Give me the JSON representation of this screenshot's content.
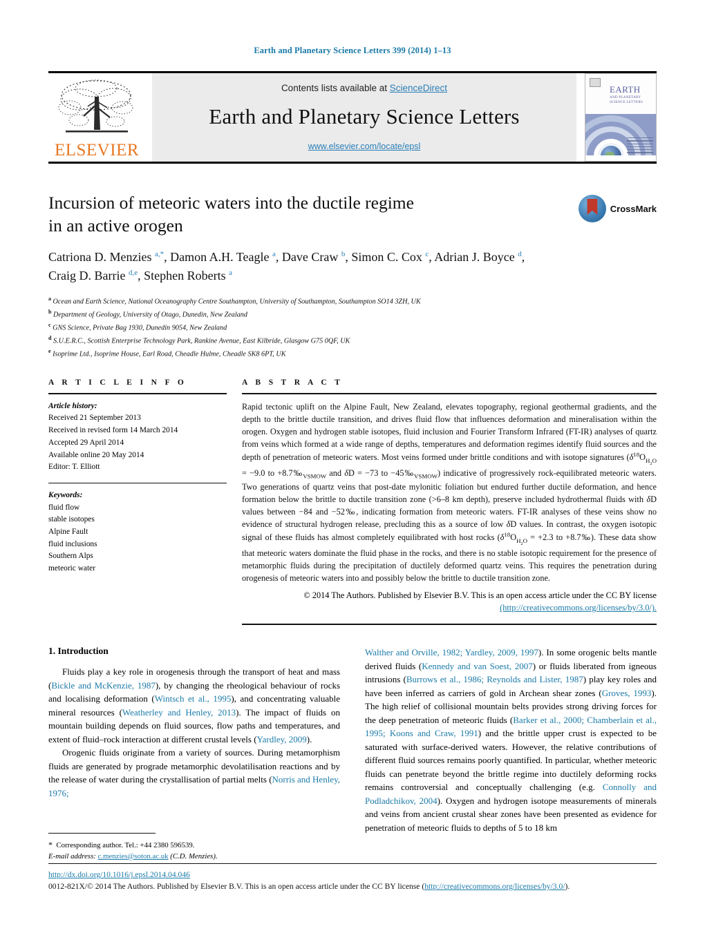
{
  "running_head": "Earth and Planetary Science Letters 399 (2014) 1–13",
  "masthead": {
    "publisher": "ELSEVIER",
    "contents_prefix": "Contents lists available at ",
    "contents_link": "ScienceDirect",
    "journal_title": "Earth and Planetary Science Letters",
    "journal_url": "www.elsevier.com/locate/epsl",
    "cover": {
      "title": "EARTH",
      "subtitle": "AND PLANETARY SCIENCE LETTERS"
    }
  },
  "article": {
    "title_line1": "Incursion of meteoric waters into the ductile regime",
    "title_line2": "in an active orogen",
    "crossmark_label": "CrossMark",
    "authors_html": "Catriona D. Menzies <sup>a,*</sup>, Damon A.H. Teagle <sup>a</sup>, Dave Craw <sup>b</sup>, Simon C. Cox <sup>c</sup>, Adrian J. Boyce <sup>d</sup>, Craig D. Barrie <sup>d,e</sup>, Stephen Roberts <sup>a</sup>",
    "affiliations": [
      {
        "mark": "a",
        "text": "Ocean and Earth Science, National Oceanography Centre Southampton, University of Southampton, Southampton SO14 3ZH, UK"
      },
      {
        "mark": "b",
        "text": "Department of Geology, University of Otago, Dunedin, New Zealand"
      },
      {
        "mark": "c",
        "text": "GNS Science, Private Bag 1930, Dunedin 9054, New Zealand"
      },
      {
        "mark": "d",
        "text": "S.U.E.R.C., Scottish Enterprise Technology Park, Rankine Avenue, East Kilbride, Glasgow G75 0QF, UK"
      },
      {
        "mark": "e",
        "text": "Isoprime Ltd., Isoprime House, Earl Road, Cheadle Hulme, Cheadle SK8 6PT, UK"
      }
    ]
  },
  "article_info": {
    "heading": "A R T I C L E   I N F O",
    "history_label": "Article history:",
    "history": [
      "Received 21 September 2013",
      "Received in revised form 14 March 2014",
      "Accepted 29 April 2014",
      "Available online 20 May 2014",
      "Editor: T. Elliott"
    ],
    "keywords_label": "Keywords:",
    "keywords": [
      "fluid flow",
      "stable isotopes",
      "Alpine Fault",
      "fluid inclusions",
      "Southern Alps",
      "meteoric water"
    ]
  },
  "abstract": {
    "heading": "A B S T R A C T",
    "text_html": "Rapid tectonic uplift on the Alpine Fault, New Zealand, elevates topography, regional geothermal gradients, and the depth to the brittle ductile transition, and drives fluid flow that influences deformation and mineralisation within the orogen. Oxygen and hydrogen stable isotopes, fluid inclusion and Fourier Transform Infrared (FT-IR) analyses of quartz from veins which formed at a wide range of depths, temperatures and deformation regimes identify fluid sources and the depth of penetration of meteoric waters. Most veins formed under brittle conditions and with isotope signatures (<span class=\"ital\">δ</span><sup>18</sup>O<sub>H<sub>2</sub>O</sub> = −9.0 to +8.7‰<sub>VSMOW</sub> and <span class=\"ital\">δ</span>D = −73 to −45‰<sub>VSMOW</sub>) indicative of progressively rock-equilibrated meteoric waters. Two generations of quartz veins that post-date mylonitic foliation but endured further ductile deformation, and hence formation below the brittle to ductile transition zone (&gt;6–8 km depth), preserve included hydrothermal fluids with <span class=\"ital\">δ</span>D values between −84 and −52‰, indicating formation from meteoric waters. FT-IR analyses of these veins show no evidence of structural hydrogen release, precluding this as a source of low <span class=\"ital\">δ</span>D values. In contrast, the oxygen isotopic signal of these fluids has almost completely equilibrated with host rocks (<span class=\"ital\">δ</span><sup>18</sup>O<sub>H<sub>2</sub>O</sub> = +2.3 to +8.7‰). These data show that meteoric waters dominate the fluid phase in the rocks, and there is no stable isotopic requirement for the presence of metamorphic fluids during the precipitation of ductilely deformed quartz veins. This requires the penetration during orogenesis of meteoric waters into and possibly below the brittle to ductile transition zone.",
    "copyright_text": "© 2014 The Authors. Published by Elsevier B.V. This is an open access article under the CC BY license",
    "license_url": "(http://creativecommons.org/licenses/by/3.0/)."
  },
  "body": {
    "section_number_title": "1.  Introduction",
    "left_paragraphs_html": [
      "Fluids play a key role in orogenesis through the transport of heat and mass (<span class=\"ref\">Bickle and McKenzie, 1987</span>), by changing the rheological behaviour of rocks and localising deformation (<span class=\"ref\">Wintsch et al., 1995</span>), and concentrating valuable mineral resources (<span class=\"ref\">Weatherley and Henley, 2013</span>). The impact of fluids on mountain building depends on fluid sources, flow paths and temperatures, and extent of fluid–rock interaction at different crustal levels (<span class=\"ref\">Yardley, 2009</span>).",
      "Orogenic fluids originate from a variety of sources. During metamorphism fluids are generated by prograde metamorphic devolatilisation reactions and by the release of water during the crystallisation of partial melts (<span class=\"ref\">Norris and Henley, 1976;</span>"
    ],
    "right_paragraphs_html": [
      "<span class=\"ref\">Walther and Orville, 1982; Yardley, 2009, 1997</span>). In some orogenic belts mantle derived fluids (<span class=\"ref\">Kennedy and van Soest, 2007</span>) or fluids liberated from igneous intrusions (<span class=\"ref\">Burrows et al., 1986; Reynolds and Lister, 1987</span>) play key roles and have been inferred as carriers of gold in Archean shear zones (<span class=\"ref\">Groves, 1993</span>). The high relief of collisional mountain belts provides strong driving forces for the deep penetration of meteoric fluids (<span class=\"ref\">Barker et al., 2000; Chamberlain et al., 1995; Koons and Craw, 1991</span>) and the brittle upper crust is expected to be saturated with surface-derived waters. However, the relative contributions of different fluid sources remains poorly quantified. In particular, whether meteoric fluids can penetrate beyond the brittle regime into ductilely deforming rocks remains controversial and conceptually challenging (e.g. <span class=\"ref\">Connolly and Podladchikov, 2004</span>). Oxygen and hydrogen isotope measurements of minerals and veins from ancient crustal shear zones have been presented as evidence for penetration of meteoric fluids to depths of 5 to 18 km"
    ]
  },
  "footnote": {
    "corresponding_html": "<span class=\"star\">*</span>&nbsp; Corresponding author. Tel.: +44 2380 596539.",
    "email_label": "E-mail address:",
    "email": "c.menzies@soton.ac.uk",
    "email_suffix": " (C.D. Menzies)."
  },
  "page_footer": {
    "doi": "http://dx.doi.org/10.1016/j.epsl.2014.04.046",
    "issn_line": "0012-821X/© 2014 The Authors. Published by Elsevier B.V. This is an open access article under the CC BY license (",
    "issn_link": "http://creativecommons.org/licenses/by/3.0/",
    "issn_tail": ")."
  },
  "colors": {
    "link": "#1a7aa8",
    "elsevier_orange": "#E87722",
    "band_grey": "#ebebeb"
  }
}
